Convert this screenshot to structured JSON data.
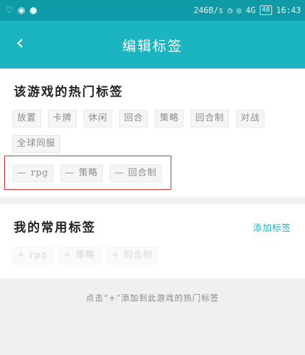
{
  "statusbar": {
    "left_icons": [
      "heart-rate-icon",
      "camera-app-icon",
      "chat-bubble-icon"
    ],
    "speed": "246B/s",
    "network": "4G",
    "battery": "48",
    "time": "16:43"
  },
  "appbar": {
    "back_icon": "back-chevron-icon",
    "title": "编辑标签"
  },
  "hot_tags": {
    "title": "该游戏的热门标签",
    "tags": [
      "放置",
      "卡牌",
      "休闲",
      "回合",
      "策略",
      "回合制",
      "对战",
      "全球同服"
    ],
    "selected": [
      "rpg",
      "策略",
      "回合制"
    ],
    "remove_symbol": "—"
  },
  "my_tags": {
    "title": "我的常用标签",
    "add_link": "添加标签",
    "tags": [
      "rpg",
      "策略",
      "回合制"
    ],
    "add_symbol": "+"
  },
  "hint": "点击“+”添加到此游戏的热门标签",
  "colors": {
    "statusbar": "#0e9aa6",
    "appbar": "#1ab5c0",
    "accent": "#1ab5c0",
    "highlight_border": "#d9272e"
  }
}
